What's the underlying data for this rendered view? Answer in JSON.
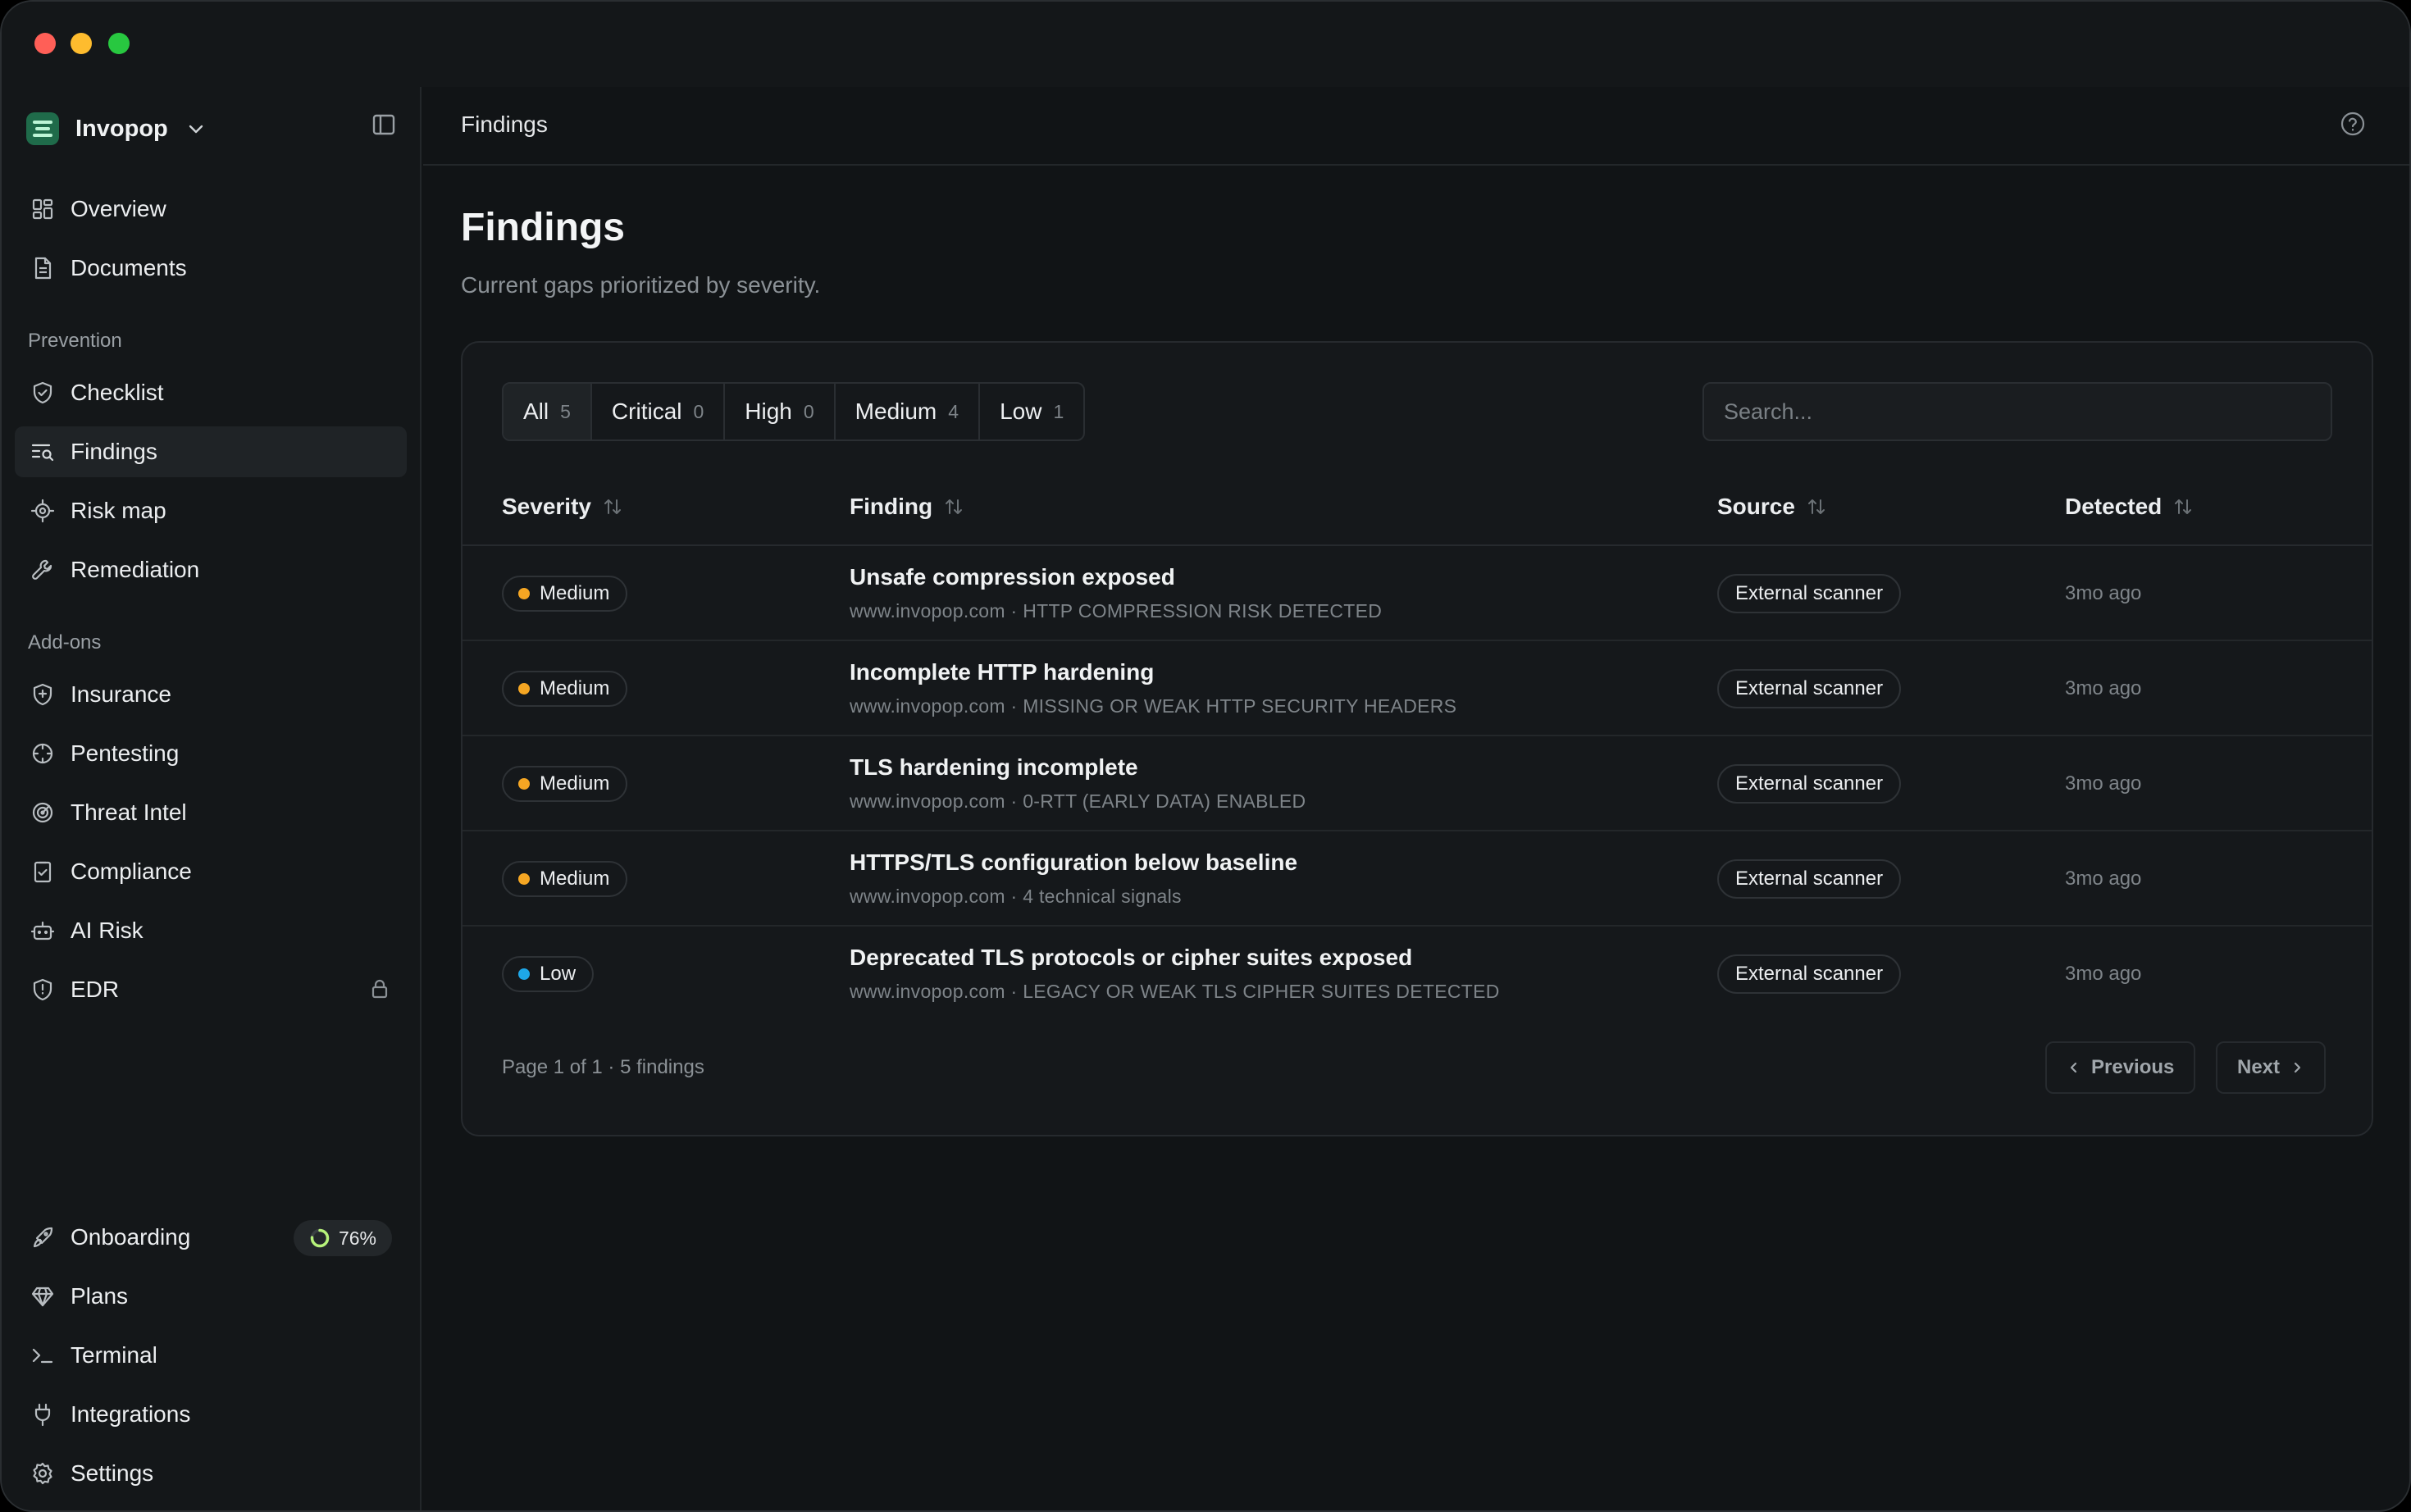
{
  "workspace": {
    "name": "Invopop"
  },
  "sidebar": {
    "top_items": [
      {
        "label": "Overview",
        "icon": "grid-icon"
      },
      {
        "label": "Documents",
        "icon": "document-icon"
      }
    ],
    "prevention_title": "Prevention",
    "prevention_items": [
      {
        "label": "Checklist",
        "icon": "shield-check-icon"
      },
      {
        "label": "Findings",
        "icon": "list-search-icon",
        "active": true
      },
      {
        "label": "Risk map",
        "icon": "target-icon"
      },
      {
        "label": "Remediation",
        "icon": "wrench-icon"
      }
    ],
    "addons_title": "Add-ons",
    "addon_items": [
      {
        "label": "Insurance",
        "icon": "shield-plus-icon"
      },
      {
        "label": "Pentesting",
        "icon": "crosshair-icon"
      },
      {
        "label": "Threat Intel",
        "icon": "radar-icon"
      },
      {
        "label": "Compliance",
        "icon": "clipboard-check-icon"
      },
      {
        "label": "AI Risk",
        "icon": "bot-icon"
      },
      {
        "label": "EDR",
        "icon": "shield-alert-icon",
        "locked": true
      }
    ],
    "bottom_items": [
      {
        "label": "Onboarding",
        "icon": "rocket-icon",
        "progress": "76%"
      },
      {
        "label": "Plans",
        "icon": "gem-icon"
      },
      {
        "label": "Terminal",
        "icon": "terminal-icon"
      },
      {
        "label": "Integrations",
        "icon": "plug-icon"
      },
      {
        "label": "Settings",
        "icon": "gear-icon"
      }
    ],
    "onboarding_progress": 0.76
  },
  "topbar": {
    "title": "Findings"
  },
  "page": {
    "title": "Findings",
    "subtitle": "Current gaps prioritized by severity."
  },
  "filters": [
    {
      "label": "All",
      "count": "5",
      "active": true
    },
    {
      "label": "Critical",
      "count": "0"
    },
    {
      "label": "High",
      "count": "0"
    },
    {
      "label": "Medium",
      "count": "4"
    },
    {
      "label": "Low",
      "count": "1"
    }
  ],
  "search": {
    "placeholder": "Search..."
  },
  "table": {
    "columns": [
      "Severity",
      "Finding",
      "Source",
      "Detected"
    ],
    "rows": [
      {
        "severity": "Medium",
        "title": "Unsafe compression exposed",
        "meta": "www.invopop.com · HTTP COMPRESSION RISK DETECTED",
        "source": "External scanner",
        "detected": "3mo ago"
      },
      {
        "severity": "Medium",
        "title": "Incomplete HTTP hardening",
        "meta": "www.invopop.com · MISSING OR WEAK HTTP SECURITY HEADERS",
        "source": "External scanner",
        "detected": "3mo ago"
      },
      {
        "severity": "Medium",
        "title": "TLS hardening incomplete",
        "meta": "www.invopop.com · 0-RTT (EARLY DATA) ENABLED",
        "source": "External scanner",
        "detected": "3mo ago"
      },
      {
        "severity": "Medium",
        "title": "HTTPS/TLS configuration below baseline",
        "meta": "www.invopop.com · 4 technical signals",
        "source": "External scanner",
        "detected": "3mo ago"
      },
      {
        "severity": "Low",
        "title": "Deprecated TLS protocols or cipher suites exposed",
        "meta": "www.invopop.com · LEGACY OR WEAK TLS CIPHER SUITES DETECTED",
        "source": "External scanner",
        "detected": "3mo ago"
      }
    ]
  },
  "severity_colors": {
    "Medium": "#f5a623",
    "Low": "#1ea7e8"
  },
  "pager": {
    "info": "Page 1 of 1 · 5 findings",
    "previous": "Previous",
    "next": "Next"
  }
}
